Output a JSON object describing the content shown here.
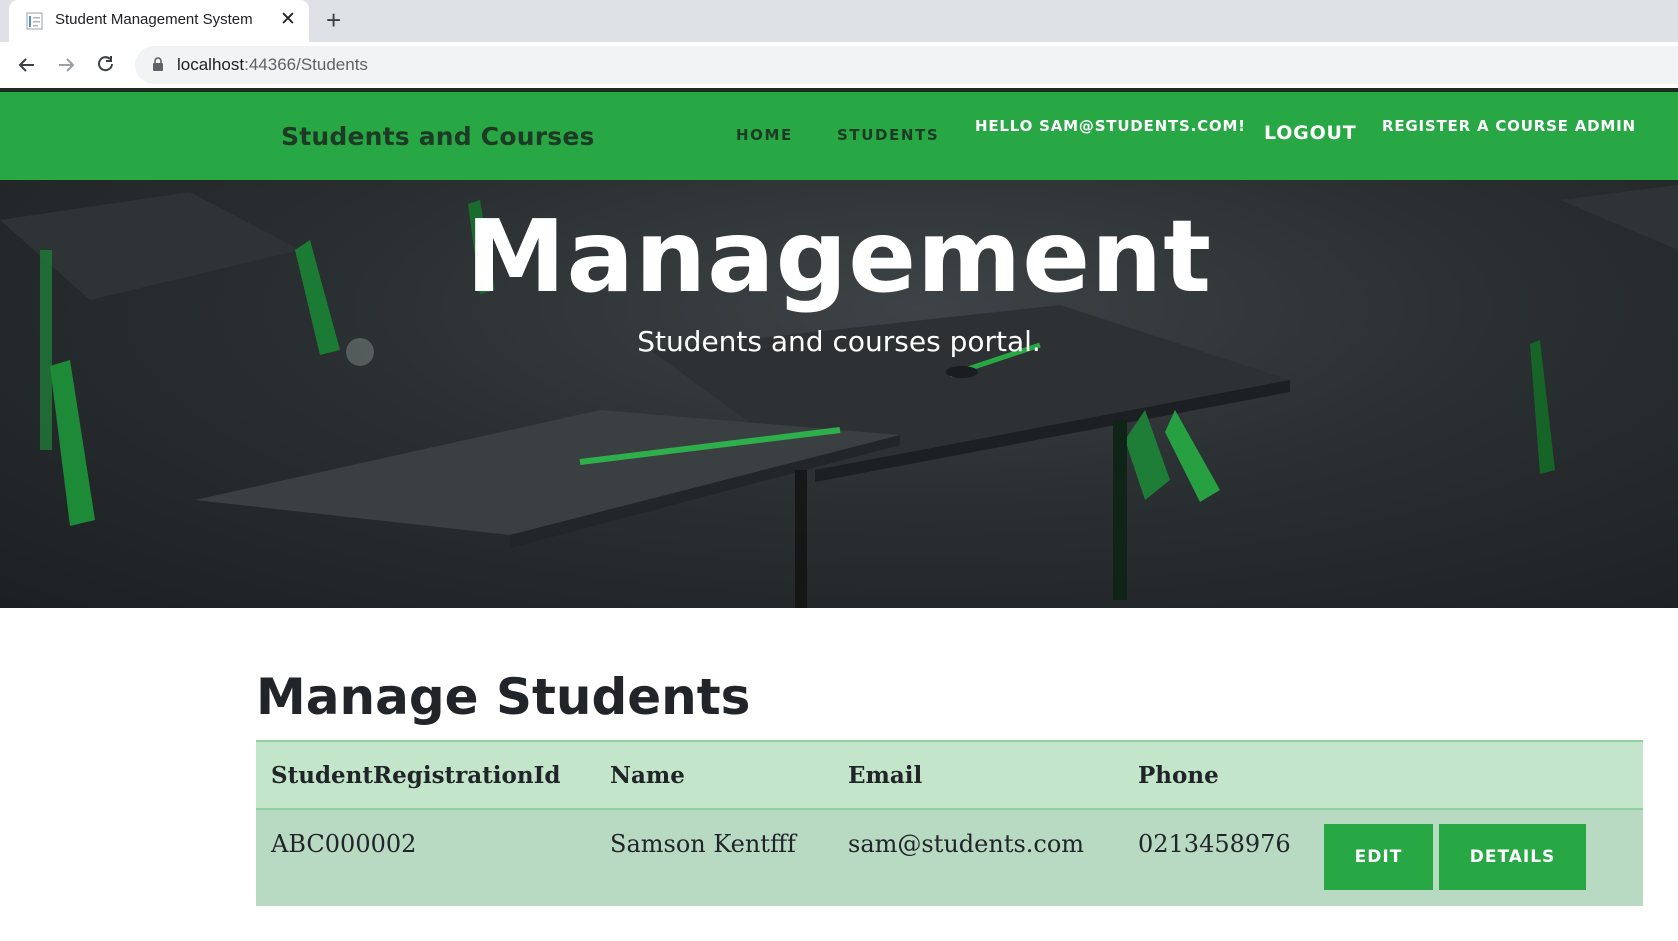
{
  "browser": {
    "tab_title": "Student Management System",
    "url_host": "localhost",
    "url_rest": ":44366/Students"
  },
  "nav": {
    "brand": "Students and Courses",
    "home": "HOME",
    "students": "STUDENTS",
    "greeting": "HELLO SAM@STUDENTS.COM!",
    "logout": "LOGOUT",
    "register": "REGISTER A COURSE ADMIN"
  },
  "hero": {
    "title": "Management",
    "subtitle": "Students and courses portal."
  },
  "main": {
    "title": "Manage Students",
    "columns": [
      "StudentRegistrationId",
      "Name",
      "Email",
      "Phone"
    ],
    "rows": [
      {
        "id": "ABC000002",
        "name": "Samson Kentfff",
        "email": "sam@students.com",
        "phone": "0213458976",
        "edit_label": "EDIT",
        "details_label": "DETAILS"
      }
    ]
  },
  "colors": {
    "brand_green": "#28a745",
    "table_header": "#c3e6cb",
    "table_row": "#b8dac3"
  }
}
